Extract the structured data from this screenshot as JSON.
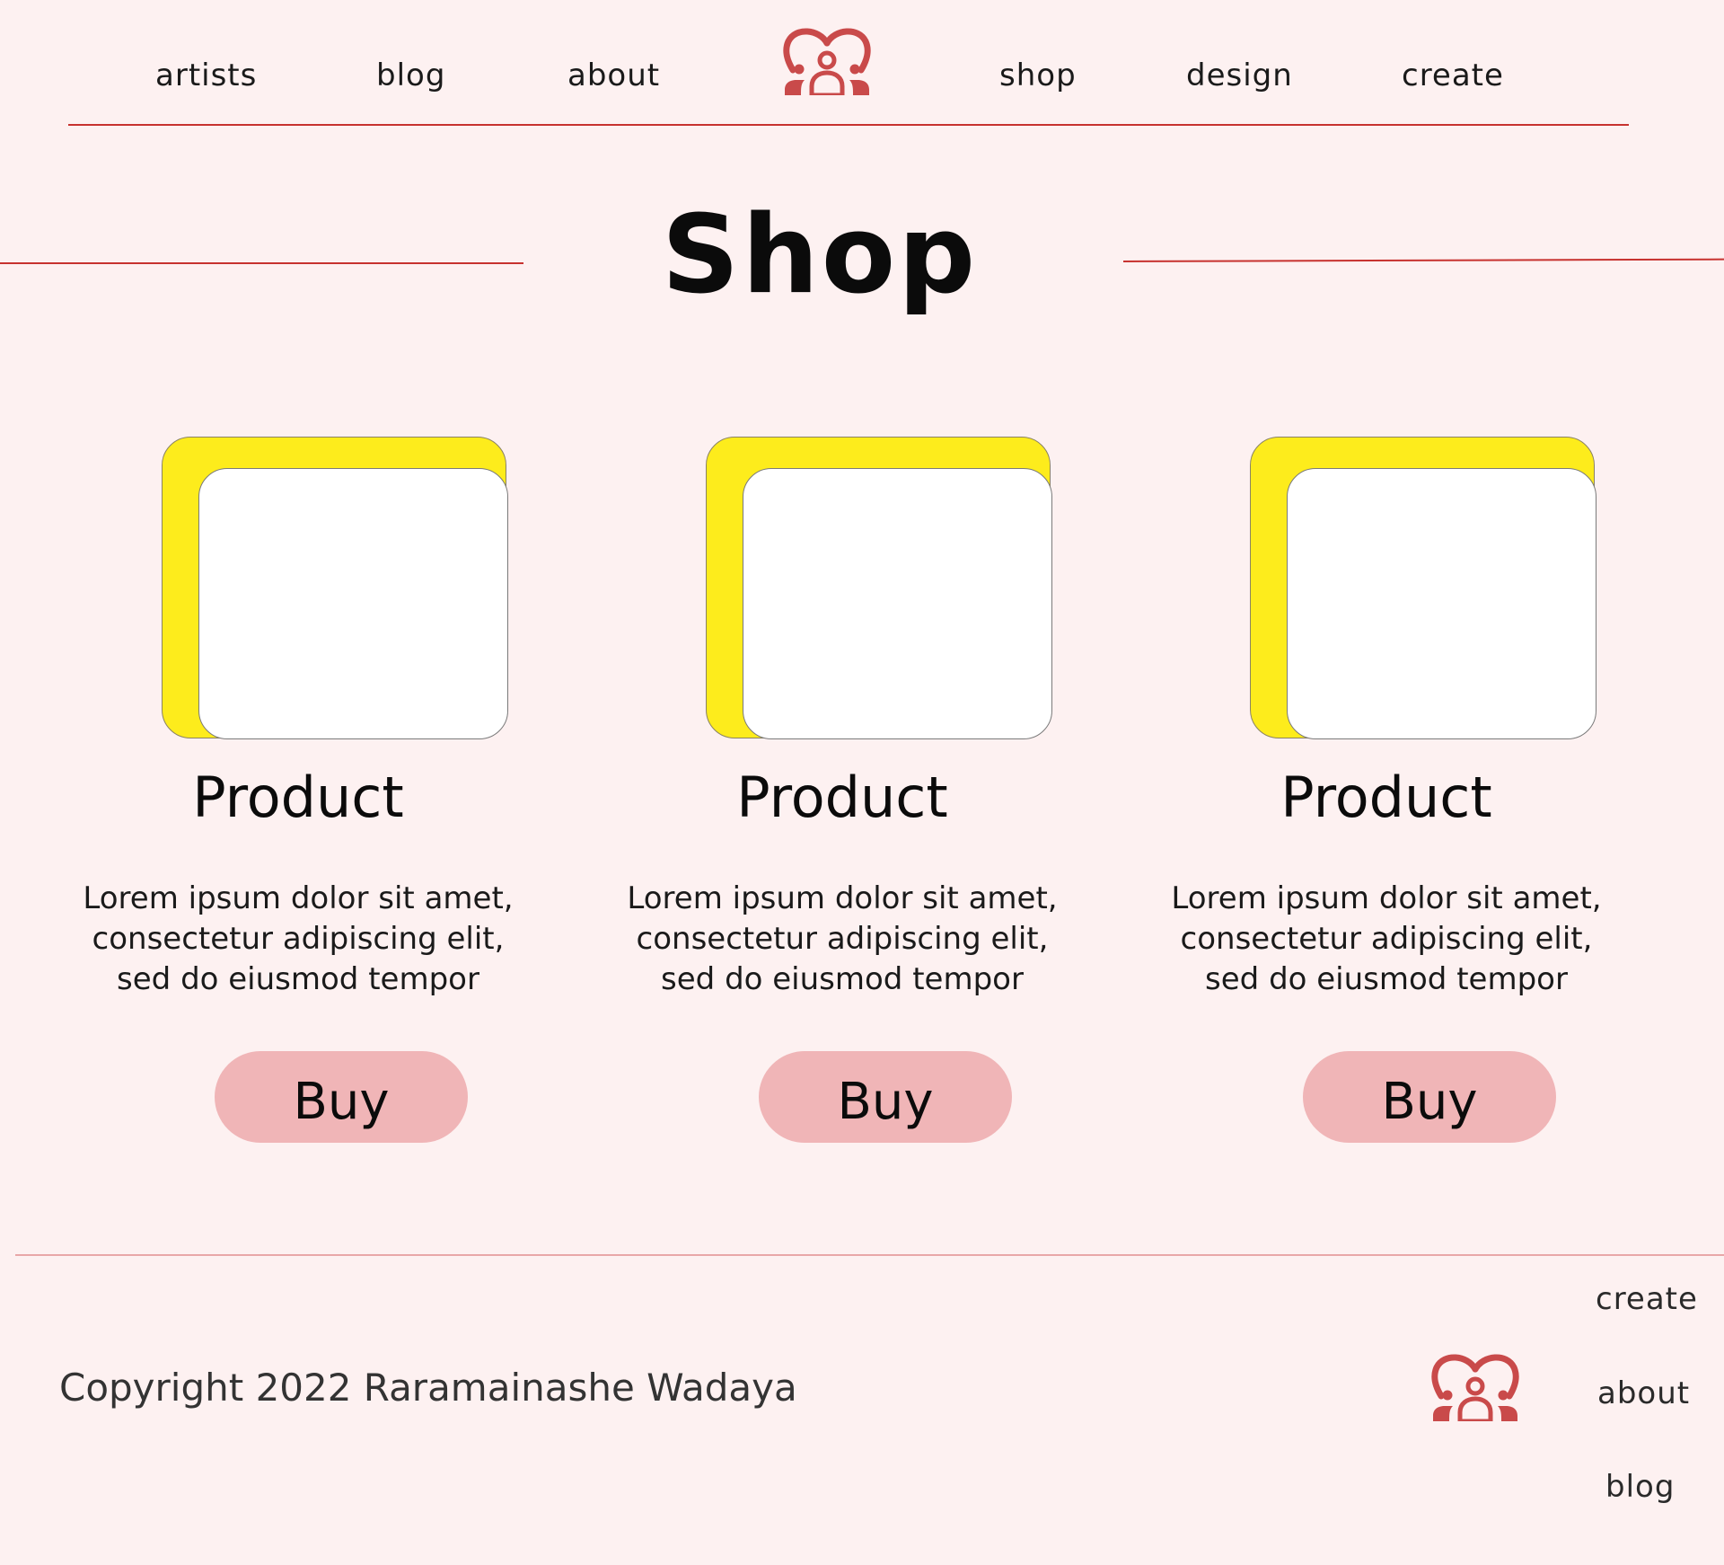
{
  "colors": {
    "background": "#fdf1f1",
    "accent_rule": "#c7322f",
    "logo": "#c94a4a",
    "card_back": "#fdec1c",
    "button": "#f0b5b7"
  },
  "header": {
    "nav_left": [
      "artists",
      "blog",
      "about"
    ],
    "nav_right": [
      "shop",
      "design",
      "create"
    ],
    "logo_icon": "heart-people-icon"
  },
  "main": {
    "title": "Shop",
    "products": [
      {
        "name": "Product",
        "description": [
          "Lorem ipsum dolor sit amet,",
          "consectetur adipiscing elit,",
          "sed do eiusmod tempor"
        ],
        "button": "Buy"
      },
      {
        "name": "Product",
        "description": [
          "Lorem ipsum dolor sit amet,",
          "consectetur adipiscing elit,",
          "sed do eiusmod tempor"
        ],
        "button": "Buy"
      },
      {
        "name": "Product",
        "description": [
          "Lorem ipsum dolor sit amet,",
          "consectetur adipiscing elit,",
          "sed do eiusmod tempor"
        ],
        "button": "Buy"
      }
    ]
  },
  "footer": {
    "copyright": "Copyright 2022 Raramainashe Wadaya",
    "links": [
      "create",
      "about",
      "blog"
    ],
    "logo_icon": "heart-people-icon"
  }
}
